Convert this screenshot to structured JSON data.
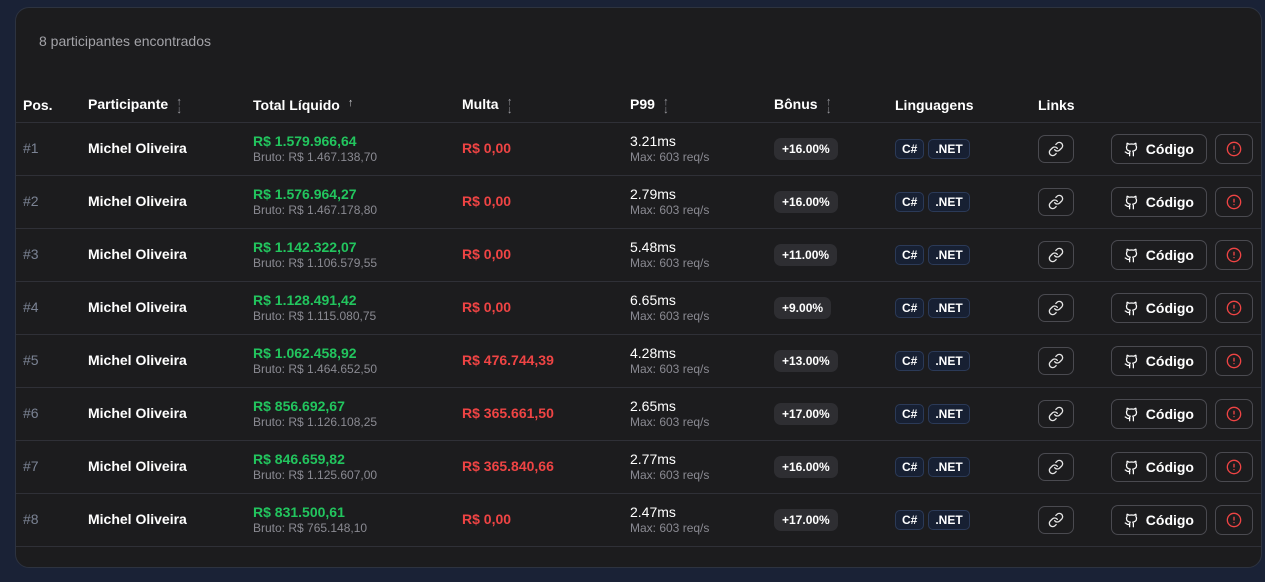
{
  "summary": "8 participantes encontrados",
  "headers": {
    "pos": "Pos.",
    "participant": "Participante",
    "total": "Total Líquido",
    "fine": "Multa",
    "p99": "P99",
    "bonus": "Bônus",
    "languages": "Linguagens",
    "links": "Links"
  },
  "code_label": "Código",
  "colors": {
    "net": "#22c55e",
    "fine": "#ef4444",
    "background": "#1c1c1e"
  },
  "rows": [
    {
      "pos": "#1",
      "name": "Michel Oliveira",
      "net": "R$ 1.579.966,64",
      "gross": "Bruto: R$ 1.467.138,70",
      "fine": "R$ 0,00",
      "p99": "3.21ms",
      "max": "Max: 603 req/s",
      "bonus": "+16.00%",
      "langs": [
        "C#",
        ".NET"
      ]
    },
    {
      "pos": "#2",
      "name": "Michel Oliveira",
      "net": "R$ 1.576.964,27",
      "gross": "Bruto: R$ 1.467.178,80",
      "fine": "R$ 0,00",
      "p99": "2.79ms",
      "max": "Max: 603 req/s",
      "bonus": "+16.00%",
      "langs": [
        "C#",
        ".NET"
      ]
    },
    {
      "pos": "#3",
      "name": "Michel Oliveira",
      "net": "R$ 1.142.322,07",
      "gross": "Bruto: R$ 1.106.579,55",
      "fine": "R$ 0,00",
      "p99": "5.48ms",
      "max": "Max: 603 req/s",
      "bonus": "+11.00%",
      "langs": [
        "C#",
        ".NET"
      ]
    },
    {
      "pos": "#4",
      "name": "Michel Oliveira",
      "net": "R$ 1.128.491,42",
      "gross": "Bruto: R$ 1.115.080,75",
      "fine": "R$ 0,00",
      "p99": "6.65ms",
      "max": "Max: 603 req/s",
      "bonus": "+9.00%",
      "langs": [
        "C#",
        ".NET"
      ]
    },
    {
      "pos": "#5",
      "name": "Michel Oliveira",
      "net": "R$ 1.062.458,92",
      "gross": "Bruto: R$ 1.464.652,50",
      "fine": "R$ 476.744,39",
      "p99": "4.28ms",
      "max": "Max: 603 req/s",
      "bonus": "+13.00%",
      "langs": [
        "C#",
        ".NET"
      ]
    },
    {
      "pos": "#6",
      "name": "Michel Oliveira",
      "net": "R$ 856.692,67",
      "gross": "Bruto: R$ 1.126.108,25",
      "fine": "R$ 365.661,50",
      "p99": "2.65ms",
      "max": "Max: 603 req/s",
      "bonus": "+17.00%",
      "langs": [
        "C#",
        ".NET"
      ]
    },
    {
      "pos": "#7",
      "name": "Michel Oliveira",
      "net": "R$ 846.659,82",
      "gross": "Bruto: R$ 1.125.607,00",
      "fine": "R$ 365.840,66",
      "p99": "2.77ms",
      "max": "Max: 603 req/s",
      "bonus": "+16.00%",
      "langs": [
        "C#",
        ".NET"
      ]
    },
    {
      "pos": "#8",
      "name": "Michel Oliveira",
      "net": "R$ 831.500,61",
      "gross": "Bruto: R$ 765.148,10",
      "fine": "R$ 0,00",
      "p99": "2.47ms",
      "max": "Max: 603 req/s",
      "bonus": "+17.00%",
      "langs": [
        "C#",
        ".NET"
      ]
    }
  ]
}
